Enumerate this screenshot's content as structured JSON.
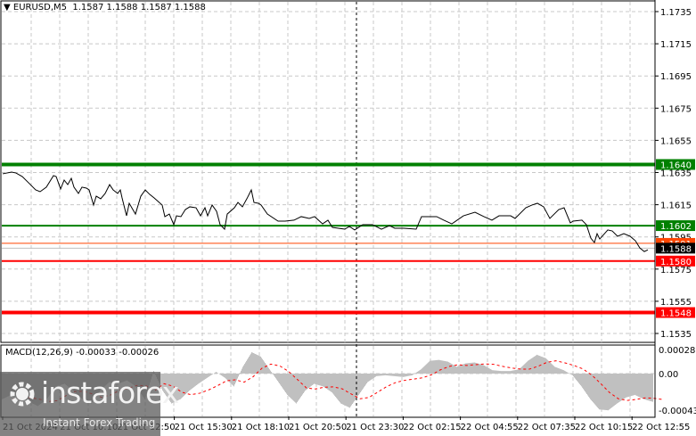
{
  "header": {
    "symbol": "EURUSD,M5",
    "values": "1.1587 1.1588 1.1587 1.1588",
    "menu_icon": "triangle-down-icon"
  },
  "macd": {
    "label": "MACD(12,26,9) -0.00033 -0.00026",
    "ticks": [
      "0.00028",
      "0.00",
      "-0.00043"
    ],
    "tick_values": [
      0.00028,
      0,
      -0.00043
    ]
  },
  "logo": {
    "name": "instaforex",
    "tagline": "Instant Forex Trading"
  },
  "colors": {
    "support_green": "#008000",
    "resistance_red": "#ff0000",
    "bid_orange": "#ff4500",
    "hist": "#c0c0c0",
    "signal": "#ff0000"
  },
  "chart_data": {
    "type": "line",
    "title": "EURUSD,M5",
    "ylim": [
      1.1526,
      1.1742
    ],
    "price_ticks": [
      "1.1735",
      "1.1715",
      "1.1695",
      "1.1675",
      "1.1655",
      "1.1635",
      "1.1615",
      "1.1595",
      "1.1575",
      "1.1555",
      "1.1535"
    ],
    "time_labels": [
      "21 Oct 2024",
      "21 Oct 10:10",
      "21 Oct 12:50",
      "21 Oct 15:30",
      "21 Oct 18:10",
      "21 Oct 20:50",
      "21 Oct 23:30",
      "22 Oct 02:15",
      "22 Oct 04:55",
      "22 Oct 07:35",
      "22 Oct 10:15",
      "22 Oct 12:55"
    ],
    "levels": [
      {
        "price": 1.164,
        "label": "1.1640",
        "color": "#008000",
        "weight": "thick"
      },
      {
        "price": 1.1602,
        "label": "1.1602",
        "color": "#008000",
        "weight": "normal"
      },
      {
        "price": 1.158,
        "label": "1.1580",
        "color": "#ff0000",
        "weight": "normal"
      },
      {
        "price": 1.1548,
        "label": "1.1548",
        "color": "#ff0000",
        "weight": "thick"
      }
    ],
    "ask": {
      "price": 1.1591,
      "label": "1.1591"
    },
    "bid": {
      "price": 1.1588,
      "label": "1.1588"
    },
    "crosshair_bar": 400,
    "series_bars": [
      3,
      13,
      18,
      25,
      33,
      40,
      45,
      52,
      60,
      63,
      68,
      72,
      76,
      80,
      83,
      88,
      92,
      97,
      100,
      105,
      108,
      113,
      118,
      123,
      127,
      132,
      135,
      137,
      142,
      145,
      152,
      158,
      163,
      168,
      173,
      182,
      185,
      190,
      195,
      198,
      203,
      208,
      213,
      220,
      225,
      230,
      233,
      238,
      243,
      247,
      252,
      255,
      263,
      267,
      272,
      277,
      282,
      285,
      290,
      293,
      300,
      312,
      320,
      330,
      338,
      347,
      353,
      362,
      368,
      373,
      387,
      392,
      398,
      407,
      418,
      428,
      437,
      443,
      453,
      467,
      473,
      480,
      490,
      498,
      507,
      520,
      533,
      543,
      552,
      560,
      573,
      578,
      590,
      597,
      603,
      610,
      617,
      627,
      633,
      640,
      643,
      653,
      658,
      663,
      667,
      670,
      673,
      682,
      687,
      693,
      700,
      707,
      713,
      718,
      723,
      727
    ],
    "series_close": [
      1.16342,
      1.16353,
      1.16347,
      1.16325,
      1.16281,
      1.16242,
      1.16231,
      1.16259,
      1.16331,
      1.16325,
      1.16248,
      1.16303,
      1.16275,
      1.16314,
      1.16259,
      1.1622,
      1.16259,
      1.16253,
      1.16242,
      1.16148,
      1.16203,
      1.16187,
      1.1622,
      1.16275,
      1.16242,
      1.1622,
      1.16242,
      1.16192,
      1.16081,
      1.16159,
      1.16092,
      1.16203,
      1.16242,
      1.16214,
      1.16192,
      1.16148,
      1.16076,
      1.16092,
      1.16026,
      1.16081,
      1.16076,
      1.1612,
      1.16137,
      1.16131,
      1.16081,
      1.16131,
      1.16081,
      1.16148,
      1.16109,
      1.16026,
      1.15998,
      1.16092,
      1.16131,
      1.16164,
      1.16137,
      1.16187,
      1.16242,
      1.16164,
      1.16159,
      1.16148,
      1.16092,
      1.16048,
      1.16048,
      1.16054,
      1.16076,
      1.16065,
      1.16076,
      1.16031,
      1.16054,
      1.16009,
      1.15998,
      1.16015,
      1.15993,
      1.16026,
      1.16026,
      1.15998,
      1.1602,
      1.16004,
      1.16004,
      1.15998,
      1.16076,
      1.16076,
      1.16076,
      1.16054,
      1.16031,
      1.16081,
      1.16103,
      1.16076,
      1.16054,
      1.16081,
      1.16081,
      1.16065,
      1.16131,
      1.16148,
      1.16159,
      1.16137,
      1.16065,
      1.1612,
      1.16131,
      1.16037,
      1.16048,
      1.16054,
      1.16026,
      1.15942,
      1.15915,
      1.1597,
      1.15937,
      1.15993,
      1.15987,
      1.15954,
      1.1597,
      1.15954,
      1.15926,
      1.15881,
      1.15859,
      1.1587
    ],
    "macd_bars_step": 10,
    "macd_hist": [
      -0.0003,
      -0.00025,
      -0.00028,
      -0.00033,
      -0.00038,
      -0.0003,
      -0.00015,
      -0.00012,
      -0.0002,
      -0.0003,
      -0.00035,
      -0.0002,
      -0.0001,
      -0.00012,
      -8e-05,
      -0.00015,
      -0.0003,
      3e-05,
      -0.0002,
      -0.00035,
      -0.0003,
      -0.0002,
      -0.00012,
      -5e-05,
      2e-05,
      -5e-05,
      -0.00015,
      8e-05,
      0.00025,
      0.0002,
      5e-05,
      -0.0001,
      -0.00025,
      -0.00035,
      -0.0002,
      -0.00012,
      -0.00015,
      -0.00022,
      -0.00035,
      -0.0004,
      -0.00025,
      -0.0001,
      -3e-05,
      -2e-05,
      -3e-05,
      -4e-05,
      -2e-05,
      5e-05,
      0.00015,
      0.00016,
      0.00014,
      8e-05,
      0.00012,
      0.00013,
      0.0001,
      4e-05,
      3e-05,
      3e-05,
      5e-05,
      0.00015,
      0.00022,
      0.00018,
      8e-05,
      4e-05,
      -2e-05,
      -0.00015,
      -0.0003,
      -0.00042,
      -0.00043,
      -0.00035,
      -0.00028,
      -0.00025,
      -0.0003,
      -0.00033
    ]
  }
}
